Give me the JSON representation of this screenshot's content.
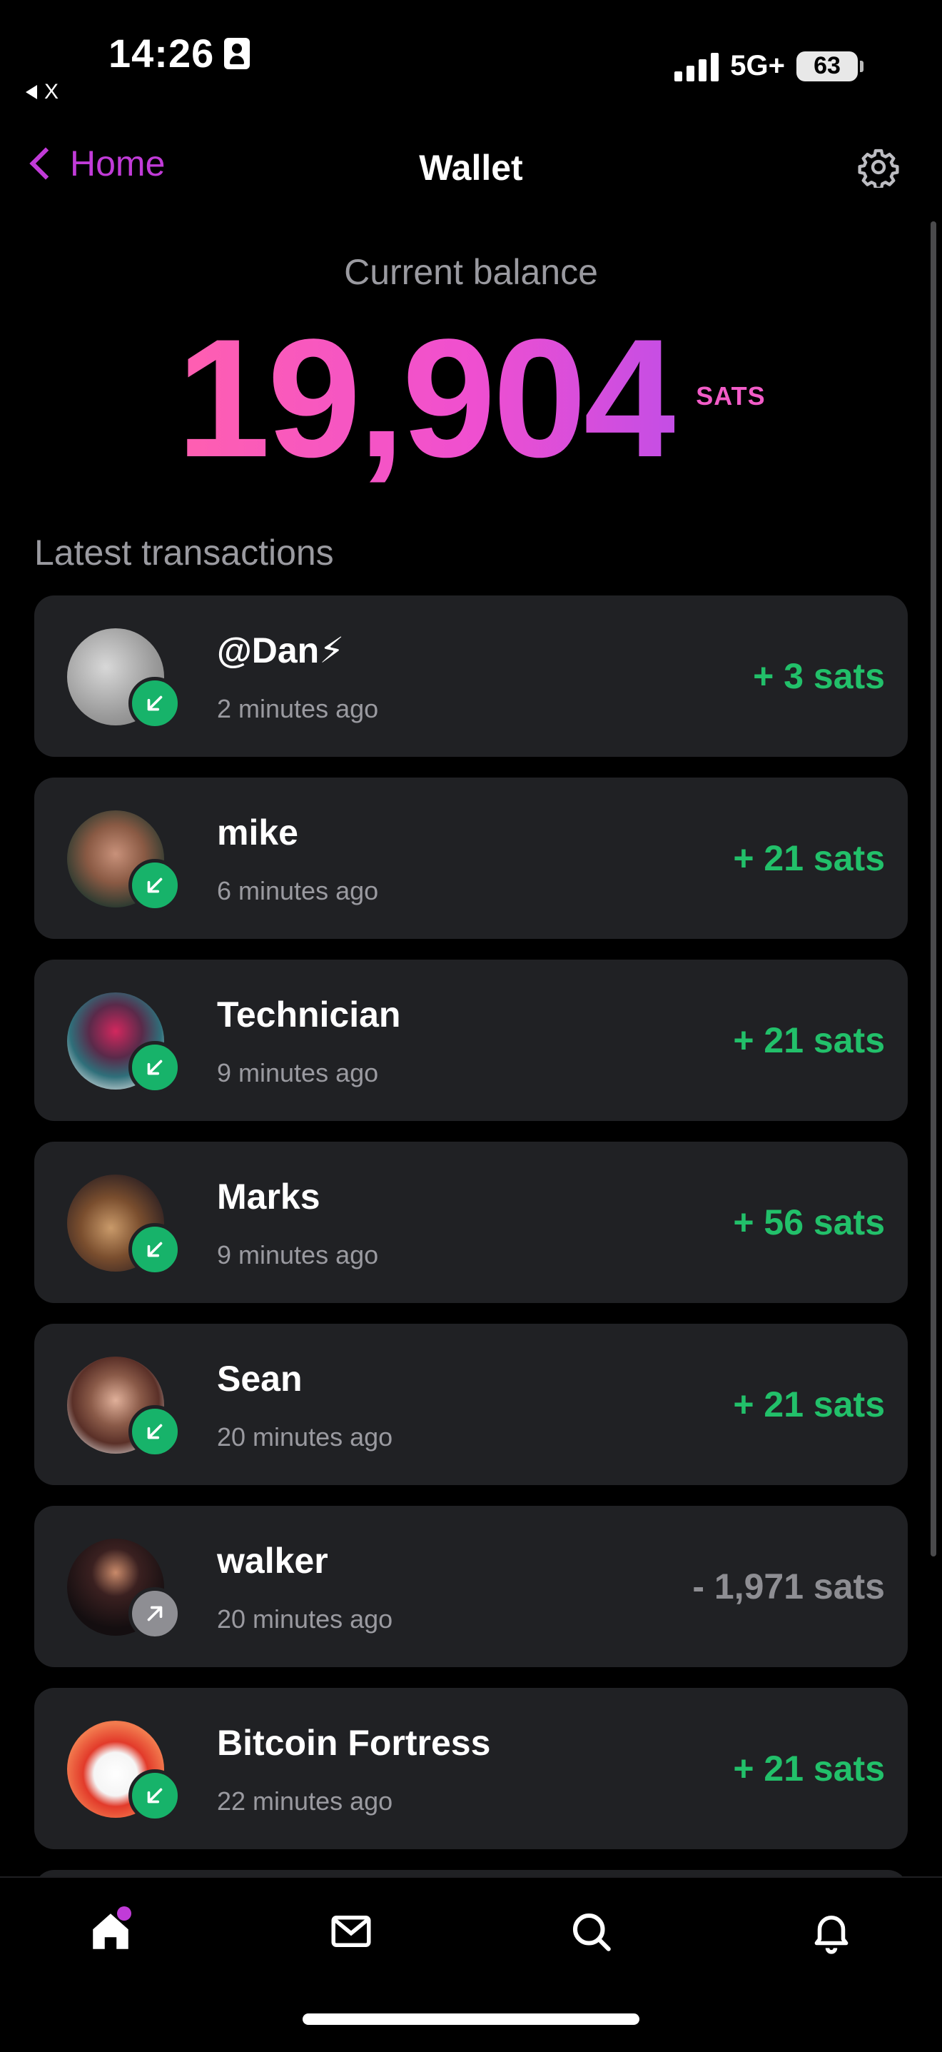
{
  "status_bar": {
    "time": "14:26",
    "back_app": "X",
    "network": "5G+",
    "battery": "63"
  },
  "nav": {
    "back_label": "Home",
    "title": "Wallet"
  },
  "balance": {
    "label": "Current balance",
    "amount": "19,904",
    "unit": "SATS"
  },
  "section_title": "Latest transactions",
  "transactions": [
    {
      "name": "@Dan⚡",
      "time": "2 minutes ago",
      "amount": "+ 3 sats",
      "direction": "in"
    },
    {
      "name": "mike",
      "time": "6 minutes ago",
      "amount": "+ 21 sats",
      "direction": "in"
    },
    {
      "name": "Technician",
      "time": "9 minutes ago",
      "amount": "+ 21 sats",
      "direction": "in"
    },
    {
      "name": "Marks",
      "time": "9 minutes ago",
      "amount": "+ 56 sats",
      "direction": "in"
    },
    {
      "name": "Sean",
      "time": "20 minutes ago",
      "amount": "+ 21 sats",
      "direction": "in"
    },
    {
      "name": "walker",
      "time": "20 minutes ago",
      "amount": "- 1,971 sats",
      "direction": "out"
    },
    {
      "name": "Bitcoin Fortress",
      "time": "22 minutes ago",
      "amount": "+ 21 sats",
      "direction": "in"
    }
  ],
  "tabs": [
    {
      "icon": "home-icon",
      "active": true
    },
    {
      "icon": "mail-icon",
      "active": false
    },
    {
      "icon": "search-icon",
      "active": false
    },
    {
      "icon": "bell-icon",
      "active": false
    }
  ],
  "colors": {
    "accent": "#c13bd8",
    "incoming": "#22c06a",
    "outgoing": "#8e8e93",
    "card": "#202124"
  }
}
